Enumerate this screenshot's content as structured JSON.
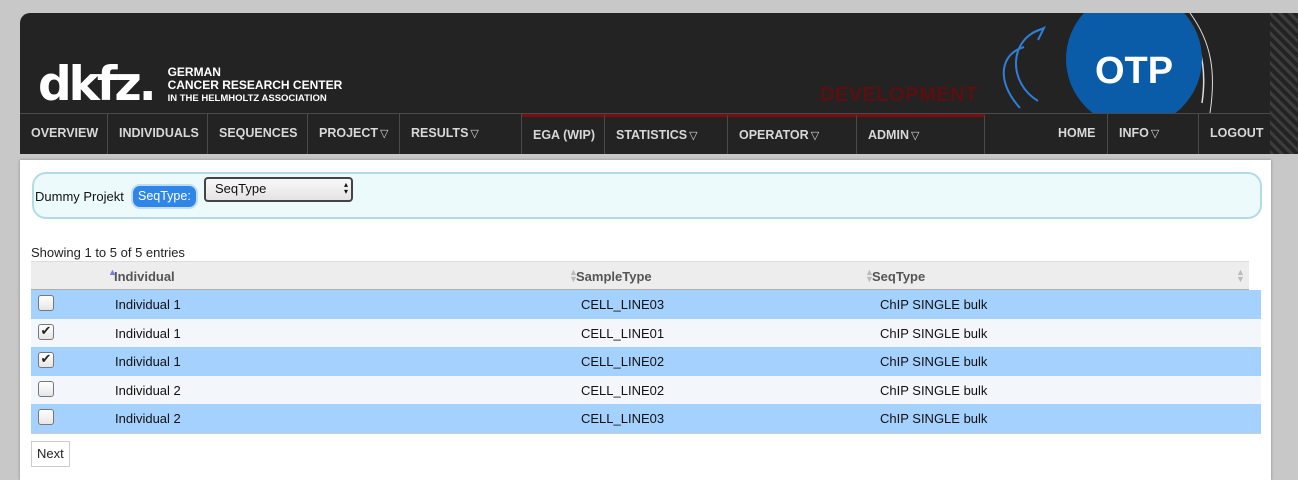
{
  "header": {
    "logo_mark": "dkfz.",
    "logo_lines": [
      "GERMAN",
      "CANCER RESEARCH CENTER",
      "IN THE HELMHOLTZ ASSOCIATION"
    ],
    "environment_label": "DEVELOPMENT",
    "app_badge": "OTP"
  },
  "nav": {
    "overview": "OVERVIEW",
    "individuals": "INDIVIDUALS",
    "sequences": "SEQUENCES",
    "project": "PROJECT",
    "results": "RESULTS",
    "ega": "EGA (WIP)",
    "statistics": "STATISTICS",
    "operator": "OPERATOR",
    "admin": "ADMIN",
    "home": "HOME",
    "info": "INFO",
    "logout": "LOGOUT",
    "caret": "▽"
  },
  "filter": {
    "project_name": "Dummy Projekt",
    "seqtype_label": "SeqType:",
    "seqtype_value": "SeqType"
  },
  "table": {
    "info": "Showing 1 to 5 of 5 entries",
    "columns": [
      "Individual",
      "SampleType",
      "SeqType"
    ],
    "rows": [
      {
        "checked": false,
        "individual": "Individual 1",
        "sample_type": "CELL_LINE03",
        "seq_type": "ChIP SINGLE bulk"
      },
      {
        "checked": true,
        "individual": "Individual 1",
        "sample_type": "CELL_LINE01",
        "seq_type": "ChIP SINGLE bulk"
      },
      {
        "checked": true,
        "individual": "Individual 1",
        "sample_type": "CELL_LINE02",
        "seq_type": "ChIP SINGLE bulk"
      },
      {
        "checked": false,
        "individual": "Individual 2",
        "sample_type": "CELL_LINE02",
        "seq_type": "ChIP SINGLE bulk"
      },
      {
        "checked": false,
        "individual": "Individual 2",
        "sample_type": "CELL_LINE03",
        "seq_type": "ChIP SINGLE bulk"
      }
    ],
    "next_label": "Next"
  },
  "colors": {
    "header_bg": "#232323",
    "row_highlight": "#a5d1fe",
    "accent_blue": "#2f86e6",
    "otp_blue": "#0a5ca8"
  }
}
